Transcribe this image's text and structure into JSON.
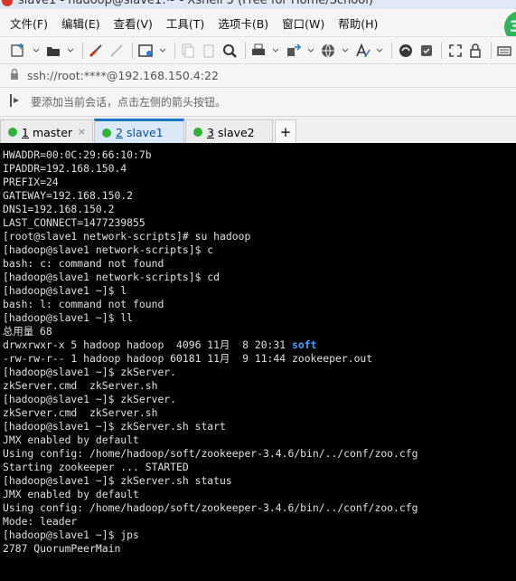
{
  "window": {
    "title": "slave1 - hadoop@slave1:~ - Xshell 5 (Free for Home/School)"
  },
  "menu": [
    "文件(F)",
    "编辑(E)",
    "查看(V)",
    "工具(T)",
    "选项卡(B)",
    "窗口(W)",
    "帮助(H)"
  ],
  "badge_text": "3",
  "address": "ssh://root:****@192.168.150.4:22",
  "hint": "要添加当前会话，点击左侧的箭头按钮。",
  "tabs": [
    {
      "num": "1",
      "label": "master",
      "active": false
    },
    {
      "num": "2",
      "label": "slave1",
      "active": true
    },
    {
      "num": "3",
      "label": "slave2",
      "active": false
    }
  ],
  "tab_close": "×",
  "tab_add": "+",
  "terminal_lines": [
    "HWADDR=00:0C:29:66:10:7b",
    "IPADDR=192.168.150.4",
    "PREFIX=24",
    "GATEWAY=192.168.150.2",
    "DNS1=192.168.150.2",
    "LAST_CONNECT=1477239855",
    "[root@slave1 network-scripts]# su hadoop",
    "[hadoop@slave1 network-scripts]$ c",
    "bash: c: command not found",
    "[hadoop@slave1 network-scripts]$ cd",
    "[hadoop@slave1 ~]$ l",
    "bash: l: command not found",
    "[hadoop@slave1 ~]$ ll",
    "总用量 68",
    "drwxrwxr-x 5 hadoop hadoop  4096 11月  8 20:31 ",
    "-rw-rw-r-- 1 hadoop hadoop 60181 11月  9 11:44 zookeeper.out",
    "[hadoop@slave1 ~]$ zkServer.",
    "zkServer.cmd  zkServer.sh",
    "[hadoop@slave1 ~]$ zkServer.",
    "zkServer.cmd  zkServer.sh",
    "[hadoop@slave1 ~]$ zkServer.sh start",
    "JMX enabled by default",
    "Using config: /home/hadoop/soft/zookeeper-3.4.6/bin/../conf/zoo.cfg",
    "Starting zookeeper ... STARTED",
    "[hadoop@slave1 ~]$ zkServer.sh status",
    "JMX enabled by default",
    "Using config: /home/hadoop/soft/zookeeper-3.4.6/bin/../conf/zoo.cfg",
    "Mode: leader",
    "[hadoop@slave1 ~]$ jps",
    "2787 QuorumPeerMain"
  ],
  "dir_name": "soft",
  "colors": {
    "terminal_bg": "#000000",
    "terminal_fg": "#e0e0e0",
    "dir_color": "#4aa0ff",
    "active_tab": "#1a73c7",
    "session_dot": "#2db432"
  }
}
